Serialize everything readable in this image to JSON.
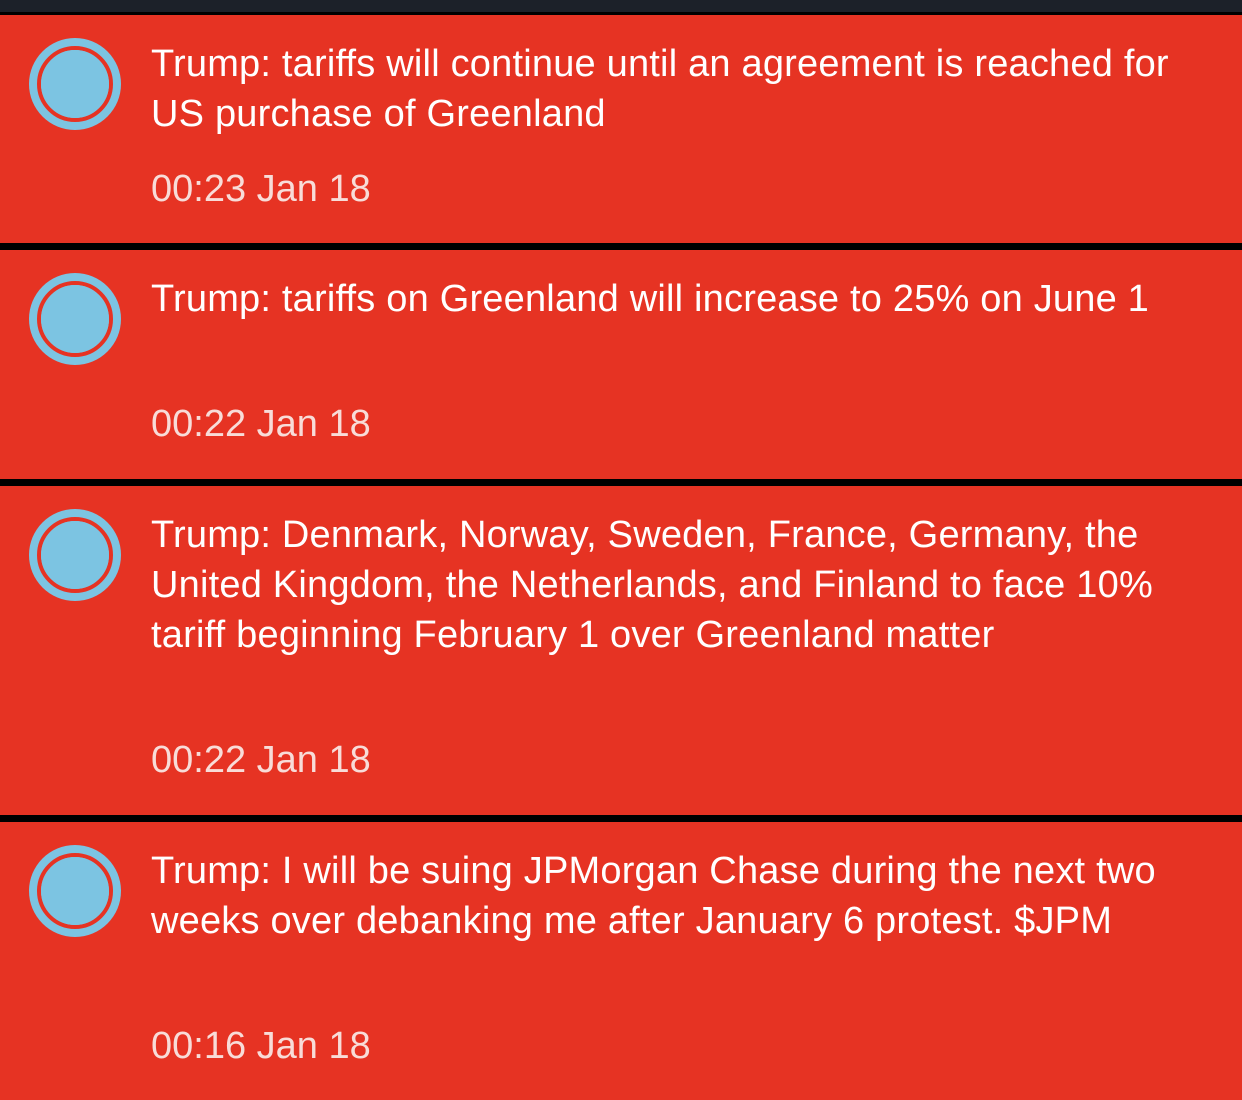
{
  "colors": {
    "card_background": "#e63323",
    "status_dot": "#7cc4e2",
    "page_background": "#000000",
    "top_bar": "#1c2129"
  },
  "feed": {
    "items": [
      {
        "icon": "status-dot-icon",
        "headline": "Trump: tariffs will continue until an agreement is reached for US purchase of Greenland",
        "timestamp": "00:23 Jan 18"
      },
      {
        "icon": "status-dot-icon",
        "headline": "Trump: tariffs on Greenland will increase to 25% on June 1",
        "timestamp": "00:22 Jan 18"
      },
      {
        "icon": "status-dot-icon",
        "headline": "Trump: Denmark, Norway, Sweden, France, Germany, the United Kingdom, the Netherlands, and Finland to face 10% tariff beginning February 1 over Greenland matter",
        "timestamp": "00:22 Jan 18"
      },
      {
        "icon": "status-dot-icon",
        "headline": "Trump: I will be suing JPMorgan Chase during the next two weeks over debanking me after January 6 protest. $JPM",
        "timestamp": "00:16 Jan 18"
      }
    ]
  }
}
